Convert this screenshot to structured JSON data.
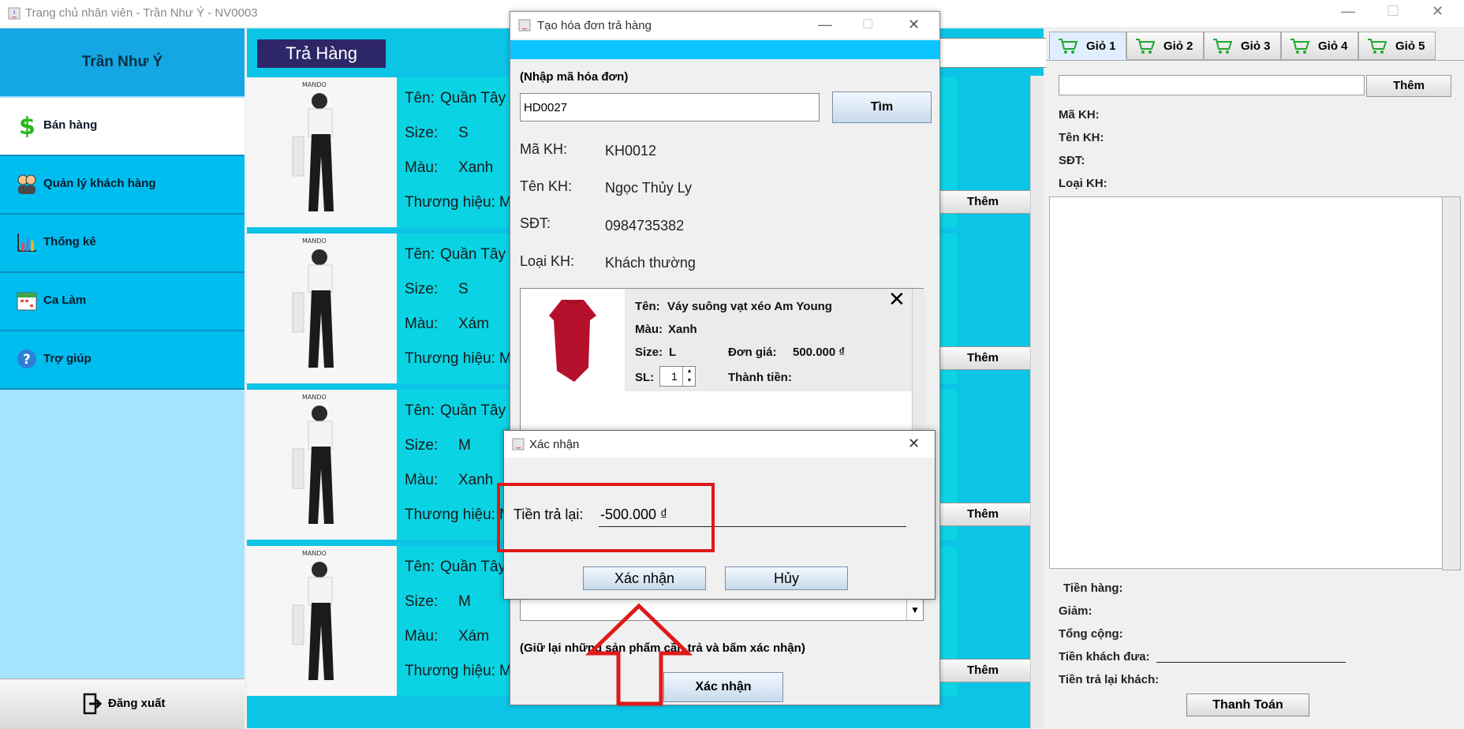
{
  "main_window": {
    "title": "Trang chủ nhân viên - Trần Như Ý - NV0003",
    "controls": {
      "minimize": "—",
      "maximize": "☐",
      "close": "✕"
    }
  },
  "sidebar": {
    "user_name": "Trần Như Ý",
    "items": [
      {
        "label": "Bán hàng",
        "icon": "dollar-icon",
        "active": true
      },
      {
        "label": "Quản lý khách hàng",
        "icon": "customers-icon",
        "active": false
      },
      {
        "label": "Thống kê",
        "icon": "chart-icon",
        "active": false
      },
      {
        "label": "Ca Làm",
        "icon": "calendar-icon",
        "active": false
      },
      {
        "label": "Trợ giúp",
        "icon": "help-icon",
        "active": false
      }
    ],
    "logout_label": "Đăng xuất"
  },
  "center": {
    "title": "Trả Hàng",
    "products": [
      {
        "name_label": "Tên:",
        "name": "Quần Tây",
        "size_label": "Size:",
        "size": "S",
        "color_label": "Màu:",
        "color": "Xanh",
        "brand_label": "Thương hiệu:",
        "brand": "M",
        "add_label": "Thêm"
      },
      {
        "name_label": "Tên:",
        "name": "Quần Tây",
        "size_label": "Size:",
        "size": "S",
        "color_label": "Màu:",
        "color": "Xám",
        "brand_label": "Thương hiệu:",
        "brand": "M",
        "add_label": "Thêm"
      },
      {
        "name_label": "Tên:",
        "name": "Quần Tây",
        "size_label": "Size:",
        "size": "M",
        "color_label": "Màu:",
        "color": "Xanh",
        "brand_label": "Thương hiệu:",
        "brand": "M",
        "add_label": "Thêm"
      },
      {
        "name_label": "Tên:",
        "name": "Quần Tây",
        "size_label": "Size:",
        "size": "M",
        "color_label": "Màu:",
        "color": "Xám",
        "brand_label": "Thương hiệu:",
        "brand": "M",
        "add_label": "Thêm"
      }
    ]
  },
  "right_panel": {
    "tabs": [
      "Giỏ 1",
      "Giỏ 2",
      "Giỏ 3",
      "Giỏ 4",
      "Giỏ 5"
    ],
    "active_tab": 0,
    "add_label": "Thêm",
    "customer_fields": [
      "Mã KH:",
      "Tên KH:",
      "SĐT:",
      "Loại KH:"
    ],
    "totals": [
      "Tiền hàng:",
      "Giảm:",
      "Tổng cộng:",
      "Tiền khách đưa:",
      "Tiền trả lại khách:"
    ],
    "pay_label": "Thanh Toán"
  },
  "return_dialog": {
    "title": "Tạo hóa đơn trả hàng",
    "invoice_prompt": "(Nhập mã hóa đơn)",
    "invoice_value": "HD0027",
    "search_label": "Tìm",
    "fields": [
      {
        "label": "Mã KH:",
        "value": "KH0012"
      },
      {
        "label": "Tên KH:",
        "value": "Ngọc Thủy Ly"
      },
      {
        "label": "SĐT:",
        "value": "0984735382"
      },
      {
        "label": "Loại KH:",
        "value": "Khách thường"
      }
    ],
    "item": {
      "name_label": "Tên:",
      "name": "Váy suông vạt xéo Am Young",
      "color_label": "Màu:",
      "color": "Xanh",
      "size_label": "Size:",
      "size": "L",
      "price_label": "Đơn giá:",
      "price": "500.000 ₫",
      "qty_label": "SL:",
      "qty": "1",
      "total_label": "Thành tiền:",
      "remove": "✕"
    },
    "hint": "(Giữ lại những sản phẩm cần trả và bấm xác nhận)",
    "confirm_label": "Xác nhận"
  },
  "confirm_dialog": {
    "title": "Xác nhận",
    "refund_label": "Tiền trả lại:",
    "refund_value": "-500.000 ₫",
    "confirm_label": "Xác nhận",
    "cancel_label": "Hủy",
    "close": "✕"
  },
  "colors": {
    "accent": "#0cc4e6",
    "sidebar_active": "#ffffff",
    "highlight": "#e01919"
  }
}
